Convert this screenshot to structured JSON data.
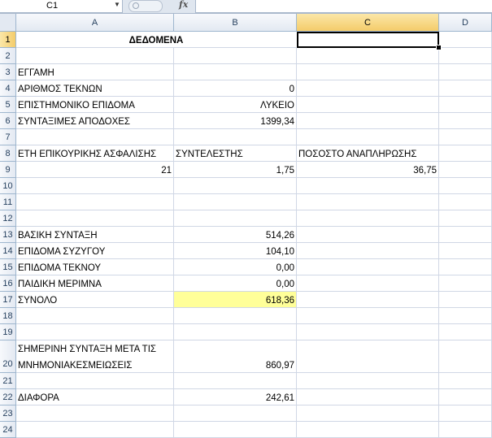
{
  "formula_bar": {
    "name_box": "C1",
    "fx_icon": "fx",
    "formula": ""
  },
  "columns": [
    "A",
    "B",
    "C",
    "D"
  ],
  "rows": [
    "1",
    "2",
    "3",
    "4",
    "5",
    "6",
    "7",
    "8",
    "9",
    "10",
    "11",
    "12",
    "13",
    "14",
    "15",
    "16",
    "17",
    "18",
    "19",
    "20",
    "21",
    "22",
    "23",
    "24"
  ],
  "cells": {
    "A1": "ΔΕΔΟΜΕΝΑ",
    "A3": "ΕΓΓΑΜΗ",
    "A4": "ΑΡΙΘΜΟΣ ΤΕΚΝΩΝ",
    "B4": "0",
    "A5": "ΕΠΙΣΤΗΜΟΝΙΚΟ ΕΠΙΔΟΜΑ",
    "B5": "ΛΥΚΕΙΟ",
    "A6": "ΣΥΝΤΑΞΙΜΕΣ ΑΠΟΔΟΧΕΣ",
    "B6": "1399,34",
    "A8": "ΕΤΗ ΕΠΙΚΟΥΡΙΚΗΣ ΑΣΦΑΛΙΣΗΣ",
    "B8": "ΣΥΝΤΕΛΕΣΤΗΣ",
    "C8": "ΠΟΣΟΣΤΟ ΑΝΑΠΛΗΡΩΣΗΣ",
    "A9": "21",
    "B9": "1,75",
    "C9": "36,75",
    "A13": "ΒΑΣΙΚΗ ΣΥΝΤΑΞΗ",
    "B13": "514,26",
    "A14": "ΕΠΙΔΟΜΑ ΣΥΖΥΓΟΥ",
    "B14": "104,10",
    "A15": "ΕΠΙΔΟΜΑ ΤΕΚΝΟΥ",
    "B15": "0,00",
    "A16": "ΠΑΙΔΙΚΗ ΜΕΡΙΜΝΑ",
    "B16": "0,00",
    "A17": "ΣΥΝΟΛΟ",
    "B17": "618,36",
    "A20a": "ΣΗΜΕΡΙΝΗ ΣΥΝΤΑΞΗ ΜΕΤΑ ΤΙΣ",
    "A20b": "ΜΝΗΜΟΝΙΑΚΕΣΜΕΙΩΣΕΙΣ",
    "B20": "860,97",
    "A22": "ΔΙΑΦΟΡΑ",
    "B22": "242,61"
  },
  "colors": {
    "highlight": "#ffff99",
    "header_selected": "#f4cc6a"
  }
}
